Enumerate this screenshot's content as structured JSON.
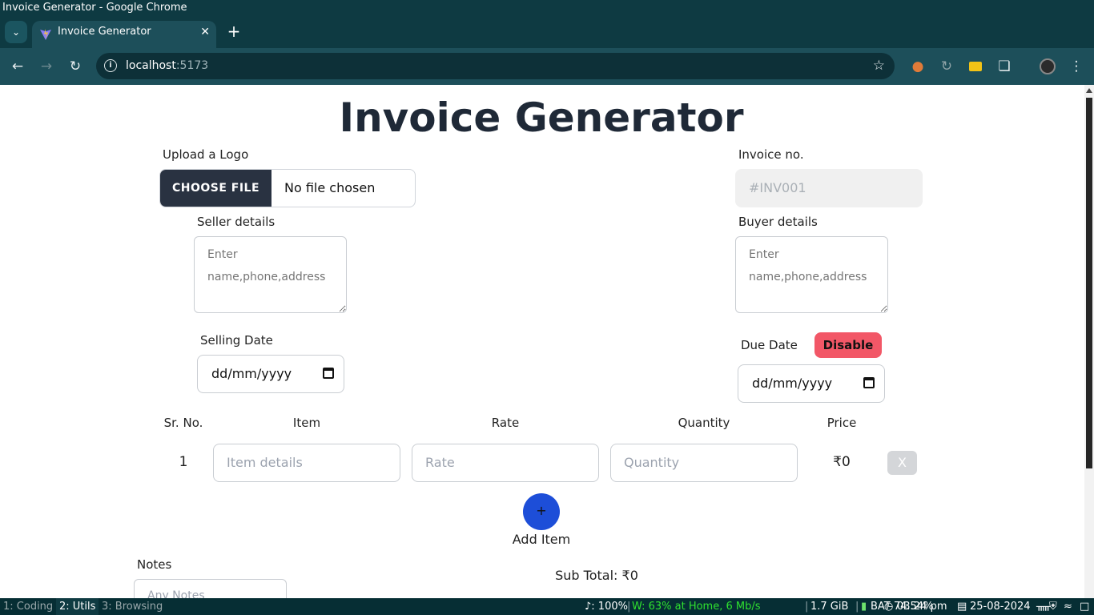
{
  "window": {
    "title": "Invoice Generator - Google Chrome"
  },
  "tab": {
    "title": "Invoice Generator",
    "close": "✕",
    "new_tab": "+"
  },
  "toolbar": {
    "url_host": "localhost",
    "url_port": ":5173"
  },
  "page": {
    "title": "Invoice Generator",
    "logo_label": "Upload a Logo",
    "file_button": "CHOOSE FILE",
    "file_status": "No file chosen",
    "invoice_no_label": "Invoice no.",
    "invoice_no_placeholder": "#INV001",
    "seller_label": "Seller details",
    "seller_placeholder": "Enter name,phone,address",
    "buyer_label": "Buyer details",
    "buyer_placeholder": "Enter name,phone,address",
    "selling_date_label": "Selling Date",
    "selling_date_value": "dd/mm/yyyy",
    "due_date_label": "Due Date",
    "disable_button": "Disable",
    "due_date_value": "dd/mm/yyyy",
    "table": {
      "headers": [
        "Sr. No.",
        "Item",
        "Rate",
        "Quantity",
        "Price"
      ],
      "rows": [
        {
          "sr": "1",
          "item_placeholder": "Item details",
          "rate_placeholder": "Rate",
          "quantity_placeholder": "Quantity",
          "price": "₹0",
          "delete": "X"
        }
      ]
    },
    "add_button_icon": "+",
    "add_item_label": "Add Item",
    "notes_label": "Notes",
    "notes_placeholder": "Any Notes",
    "subtotal": "Sub Total: ₹0"
  },
  "statusbar": {
    "workspaces": [
      "1: Coding",
      "2: Utils",
      "3: Browsing"
    ],
    "volume": "♪: 100%",
    "wifi": "W:  63% at Home, 6 Mb/s",
    "memory": "1.7 GiB",
    "battery": "BAT 74.54%",
    "time": "03:24 pm",
    "date": "25-08-2024"
  }
}
